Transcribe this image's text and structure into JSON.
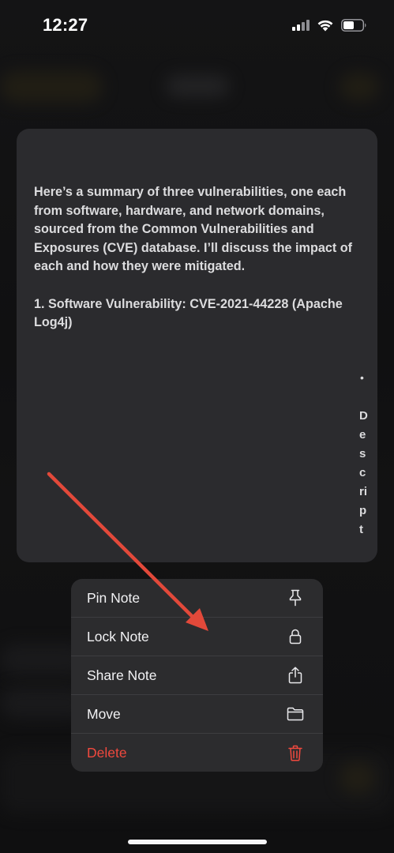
{
  "status_bar": {
    "time": "12:27"
  },
  "note_preview": {
    "paragraphs": [
      "Here’s a summary of three vulnerabilities, one each from software, hardware, and network domains, sourced from the Common Vulnerabilities and Exposures (CVE) database. I’ll discuss the impact of each and how they were mitigated.",
      "1. Software Vulnerability: CVE-2021-44228 (Apache Log4j)"
    ],
    "bullet": "•",
    "vertical_text": "Descript"
  },
  "context_menu": {
    "items": [
      {
        "label": "Pin Note",
        "icon": "pin-icon"
      },
      {
        "label": "Lock Note",
        "icon": "lock-icon"
      },
      {
        "label": "Share Note",
        "icon": "share-icon"
      },
      {
        "label": "Move",
        "icon": "folder-icon"
      },
      {
        "label": "Delete",
        "icon": "trash-icon"
      }
    ]
  },
  "colors": {
    "menu_background": "#2c2c2e",
    "card_background": "#2b2b2e",
    "destructive": "#f0493e",
    "annotation_arrow": "#e2493a"
  }
}
